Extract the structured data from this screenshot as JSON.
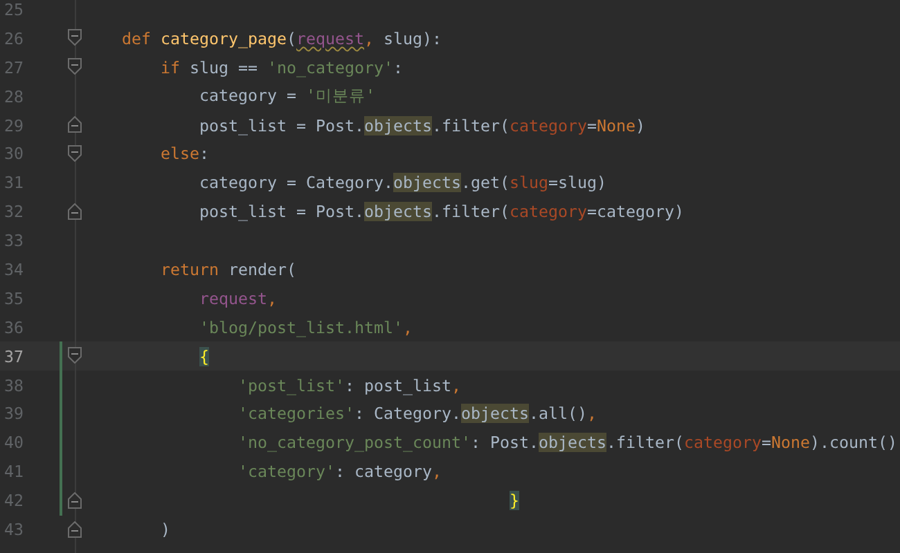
{
  "editor": {
    "lines": [
      {
        "number": "25",
        "kind": "plain",
        "changed": false,
        "current": false
      },
      {
        "number": "26",
        "kind": "fold-start",
        "changed": false,
        "current": false,
        "tokens": [
          {
            "text": "def ",
            "kind": "keyword"
          },
          {
            "text": "category_page",
            "kind": "function"
          },
          {
            "text": "(",
            "kind": "plain"
          },
          {
            "text": "request",
            "kind": "param-warning"
          },
          {
            "text": ",",
            "kind": "comma"
          },
          {
            "text": " slug):",
            "kind": "plain"
          }
        ]
      },
      {
        "number": "27",
        "kind": "fold-start",
        "changed": false,
        "current": false,
        "tokens": [
          {
            "text": "    if",
            "kind": "keyword"
          },
          {
            "text": " slug == ",
            "kind": "plain"
          },
          {
            "text": "'no_category'",
            "kind": "string"
          },
          {
            "text": ":",
            "kind": "plain"
          }
        ]
      },
      {
        "number": "28",
        "kind": "plain",
        "changed": false,
        "current": false,
        "tokens": [
          {
            "text": "        category = ",
            "kind": "plain"
          },
          {
            "text": "'미분류'",
            "kind": "string"
          }
        ]
      },
      {
        "number": "29",
        "kind": "fold-end",
        "changed": false,
        "current": false,
        "tokens": [
          {
            "text": "        post_list = Post.",
            "kind": "plain"
          },
          {
            "text": "objects",
            "kind": "highlight"
          },
          {
            "text": ".filter(",
            "kind": "plain"
          },
          {
            "text": "category",
            "kind": "kwarg"
          },
          {
            "text": "=",
            "kind": "plain"
          },
          {
            "text": "None",
            "kind": "keyword"
          },
          {
            "text": ")",
            "kind": "plain"
          }
        ]
      },
      {
        "number": "30",
        "kind": "fold-start",
        "changed": false,
        "current": false,
        "tokens": [
          {
            "text": "    else",
            "kind": "keyword"
          },
          {
            "text": ":",
            "kind": "plain"
          }
        ]
      },
      {
        "number": "31",
        "kind": "plain",
        "changed": false,
        "current": false,
        "tokens": [
          {
            "text": "        category = Category.",
            "kind": "plain"
          },
          {
            "text": "objects",
            "kind": "highlight"
          },
          {
            "text": ".get(",
            "kind": "plain"
          },
          {
            "text": "slug",
            "kind": "kwarg"
          },
          {
            "text": "=slug)",
            "kind": "plain"
          }
        ]
      },
      {
        "number": "32",
        "kind": "fold-end",
        "changed": false,
        "current": false,
        "tokens": [
          {
            "text": "        post_list = Post.",
            "kind": "plain"
          },
          {
            "text": "objects",
            "kind": "highlight"
          },
          {
            "text": ".filter(",
            "kind": "plain"
          },
          {
            "text": "category",
            "kind": "kwarg"
          },
          {
            "text": "=category)",
            "kind": "plain"
          }
        ]
      },
      {
        "number": "33",
        "kind": "plain",
        "changed": false,
        "current": false
      },
      {
        "number": "34",
        "kind": "plain",
        "changed": false,
        "current": false,
        "tokens": [
          {
            "text": "    return",
            "kind": "keyword"
          },
          {
            "text": " render(",
            "kind": "plain"
          }
        ]
      },
      {
        "number": "35",
        "kind": "plain",
        "changed": false,
        "current": false,
        "tokens": [
          {
            "text": "        request",
            "kind": "param"
          },
          {
            "text": ",",
            "kind": "comma"
          }
        ]
      },
      {
        "number": "36",
        "kind": "plain",
        "changed": false,
        "current": false,
        "tokens": [
          {
            "text": "        'blog/post_list.html'",
            "kind": "string"
          },
          {
            "text": ",",
            "kind": "comma"
          }
        ]
      },
      {
        "number": "37",
        "kind": "fold-start",
        "changed": true,
        "current": true,
        "tokens": [
          {
            "text": "        {",
            "kind": "brace-match"
          }
        ]
      },
      {
        "number": "38",
        "kind": "plain",
        "changed": true,
        "current": false,
        "tokens": [
          {
            "text": "            'post_list'",
            "kind": "string"
          },
          {
            "text": ": post_list",
            "kind": "plain"
          },
          {
            "text": ",",
            "kind": "comma"
          }
        ]
      },
      {
        "number": "39",
        "kind": "plain",
        "changed": true,
        "current": false,
        "tokens": [
          {
            "text": "            'categories'",
            "kind": "string"
          },
          {
            "text": ": Category.",
            "kind": "plain"
          },
          {
            "text": "objects",
            "kind": "highlight"
          },
          {
            "text": ".all()",
            "kind": "plain"
          },
          {
            "text": ",",
            "kind": "comma"
          }
        ]
      },
      {
        "number": "40",
        "kind": "plain",
        "changed": true,
        "current": false,
        "tokens": [
          {
            "text": "            'no_category_post_count'",
            "kind": "string"
          },
          {
            "text": ": Post.",
            "kind": "plain"
          },
          {
            "text": "objects",
            "kind": "highlight"
          },
          {
            "text": ".filter(",
            "kind": "plain"
          },
          {
            "text": "category",
            "kind": "kwarg"
          },
          {
            "text": "=",
            "kind": "plain"
          },
          {
            "text": "None",
            "kind": "keyword"
          },
          {
            "text": ").count()",
            "kind": "plain"
          }
        ]
      },
      {
        "number": "41",
        "kind": "plain",
        "changed": true,
        "current": false,
        "tokens": [
          {
            "text": "            'category'",
            "kind": "string"
          },
          {
            "text": ": category",
            "kind": "plain"
          },
          {
            "text": ",",
            "kind": "comma"
          }
        ]
      },
      {
        "number": "42",
        "kind": "fold-end",
        "changed": true,
        "current": false,
        "tokens": [
          {
            "text": "                                        }",
            "kind": "brace-match"
          }
        ]
      },
      {
        "number": "43",
        "kind": "fold-end",
        "changed": false,
        "current": false,
        "tokens": [
          {
            "text": "    )",
            "kind": "plain"
          }
        ]
      }
    ]
  }
}
